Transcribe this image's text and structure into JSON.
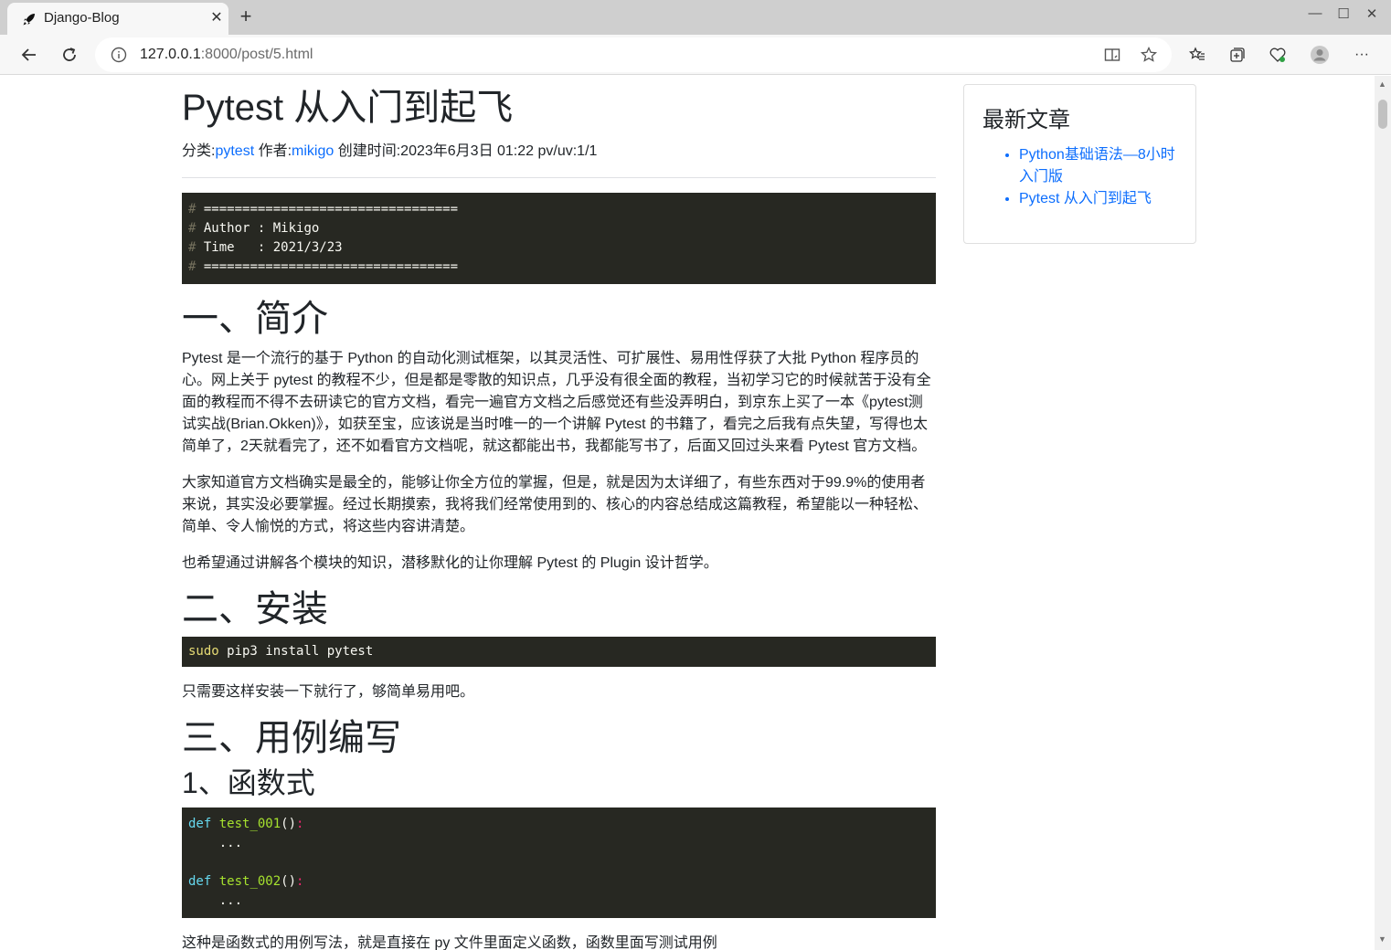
{
  "browser": {
    "tab_title": "Django-Blog",
    "url_host": "127.0.0.1",
    "url_rest": ":8000/post/5.html"
  },
  "post": {
    "title": "Pytest 从入门到起飞",
    "meta": {
      "category_label": "分类:",
      "category": "pytest",
      "author_label": " 作者:",
      "author": "mikigo",
      "created": " 创建时间:2023年6月3日 01:22 pv/uv:1/1"
    },
    "header_code": [
      {
        "comment": "#",
        "text": " ================================="
      },
      {
        "comment": "#",
        "text": " Author : Mikigo"
      },
      {
        "comment": "#",
        "text": " Time   : 2021/3/23"
      },
      {
        "comment": "#",
        "text": " ================================="
      }
    ],
    "sections": {
      "intro_heading": "一、简介",
      "intro_p1": "Pytest 是一个流行的基于 Python 的自动化测试框架，以其灵活性、可扩展性、易用性俘获了大批 Python 程序员的心。网上关于 pytest 的教程不少，但是都是零散的知识点，几乎没有很全面的教程，当初学习它的时候就苦于没有全面的教程而不得不去研读它的官方文档，看完一遍官方文档之后感觉还有些没弄明白，到京东上买了一本《pytest测试实战(Brian.Okken)》，如获至宝，应该说是当时唯一的一个讲解 Pytest 的书籍了，看完之后我有点失望，写得也太简单了，2天就看完了，还不如看官方文档呢，就这都能出书，我都能写书了，后面又回过头来看 Pytest 官方文档。",
      "intro_p2": "大家知道官方文档确实是最全的，能够让你全方位的掌握，但是，就是因为太详细了，有些东西对于99.9%的使用者来说，其实没必要掌握。经过长期摸索，我将我们经常使用到的、核心的内容总结成这篇教程，希望能以一种轻松、简单、令人愉悦的方式，将这些内容讲清楚。",
      "intro_p3": "也希望通过讲解各个模块的知识，潜移默化的让你理解 Pytest 的 Plugin 设计哲学。",
      "install_heading": "二、安装",
      "install_cmd": "sudo",
      "install_rest": " pip3 install pytest",
      "install_p": "只需要这样安装一下就行了，够简单易用吧。",
      "cases_heading": "三、用例编写",
      "func_heading": "1、函数式",
      "func_code": {
        "kw": "def",
        "fn1": "test_001",
        "fn2": "test_002",
        "parens": "()",
        "colon": ":",
        "body": "    ..."
      },
      "func_p": "这种是函数式的用例写法，就是直接在 py 文件里面定义函数，函数里面写测试用例"
    }
  },
  "sidebar": {
    "title": "最新文章",
    "items": [
      {
        "label": "Python基础语法—8小时入门版"
      },
      {
        "label": "Pytest 从入门到起飞"
      }
    ]
  }
}
